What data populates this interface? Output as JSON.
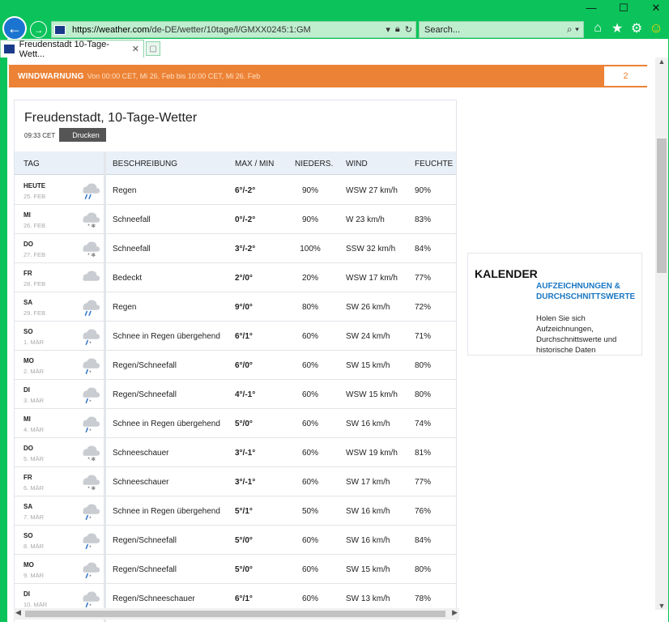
{
  "browser": {
    "url_host": "https://weather.com",
    "url_path": "/de-DE/wetter/10tage/l/GMXX0245:1:GM",
    "search_placeholder": "Search...",
    "tab_title": "Freudenstadt 10-Tage-Wett...",
    "tab_close": "✕"
  },
  "warning": {
    "title": "WINDWARNUNG",
    "time": "Von 00:00 CET, Mi 26. Feb bis 10:00 CET, Mi 26. Feb",
    "count": "2"
  },
  "page": {
    "title": "Freudenstadt, 10-Tage-Wetter",
    "time": "09:33 CET",
    "print_label": "Drucken"
  },
  "table": {
    "headers": {
      "day": "TAG",
      "desc": "BESCHREIBUNG",
      "temp": "MAX / MIN",
      "prec": "NIEDERS.",
      "wind": "WIND",
      "hum": "FEUCHTE"
    },
    "rows": [
      {
        "day": "HEUTE",
        "date": "25. FEB",
        "icon": "rain-icon",
        "desc": "Regen",
        "temp": "6°/-2°",
        "prec": "90%",
        "wind": "WSW 27 km/h",
        "hum": "90%"
      },
      {
        "day": "MI",
        "date": "26. FEB",
        "icon": "snow-icon",
        "desc": "Schneefall",
        "temp": "0°/-2°",
        "prec": "90%",
        "wind": "W 23 km/h",
        "hum": "83%"
      },
      {
        "day": "DO",
        "date": "27. FEB",
        "icon": "snow-icon",
        "desc": "Schneefall",
        "temp": "3°/-2°",
        "prec": "100%",
        "wind": "SSW 32 km/h",
        "hum": "84%"
      },
      {
        "day": "FR",
        "date": "28. FEB",
        "icon": "cloud-icon",
        "desc": "Bedeckt",
        "temp": "2°/0°",
        "prec": "20%",
        "wind": "WSW 17 km/h",
        "hum": "77%"
      },
      {
        "day": "SA",
        "date": "29. FEB",
        "icon": "rain-icon",
        "desc": "Regen",
        "temp": "9°/0°",
        "prec": "80%",
        "wind": "SW 26 km/h",
        "hum": "72%"
      },
      {
        "day": "SO",
        "date": "1. MÄR",
        "icon": "rain-snow-icon",
        "desc": "Schnee in Regen übergehend",
        "temp": "6°/1°",
        "prec": "60%",
        "wind": "SW 24 km/h",
        "hum": "71%"
      },
      {
        "day": "MO",
        "date": "2. MÄR",
        "icon": "rain-snow-icon",
        "desc": "Regen/Schneefall",
        "temp": "6°/0°",
        "prec": "60%",
        "wind": "SW 15 km/h",
        "hum": "80%"
      },
      {
        "day": "DI",
        "date": "3. MÄR",
        "icon": "rain-snow-icon",
        "desc": "Regen/Schneefall",
        "temp": "4°/-1°",
        "prec": "60%",
        "wind": "WSW 15 km/h",
        "hum": "80%"
      },
      {
        "day": "MI",
        "date": "4. MÄR",
        "icon": "rain-snow-icon",
        "desc": "Schnee in Regen übergehend",
        "temp": "5°/0°",
        "prec": "60%",
        "wind": "SW 16 km/h",
        "hum": "74%"
      },
      {
        "day": "DO",
        "date": "5. MÄR",
        "icon": "snow-icon",
        "desc": "Schneeschauer",
        "temp": "3°/-1°",
        "prec": "60%",
        "wind": "WSW 19 km/h",
        "hum": "81%"
      },
      {
        "day": "FR",
        "date": "6. MÄR",
        "icon": "snow-icon",
        "desc": "Schneeschauer",
        "temp": "3°/-1°",
        "prec": "60%",
        "wind": "SW 17 km/h",
        "hum": "77%"
      },
      {
        "day": "SA",
        "date": "7. MÄR",
        "icon": "rain-snow-icon",
        "desc": "Schnee in Regen übergehend",
        "temp": "5°/1°",
        "prec": "50%",
        "wind": "SW 16 km/h",
        "hum": "76%"
      },
      {
        "day": "SO",
        "date": "8. MÄR",
        "icon": "rain-snow-icon",
        "desc": "Regen/Schneefall",
        "temp": "5°/0°",
        "prec": "60%",
        "wind": "SW 16 km/h",
        "hum": "84%"
      },
      {
        "day": "MO",
        "date": "9. MÄR",
        "icon": "rain-snow-icon",
        "desc": "Regen/Schneefall",
        "temp": "5°/0°",
        "prec": "60%",
        "wind": "SW 15 km/h",
        "hum": "80%"
      },
      {
        "day": "DI",
        "date": "10. MÄR",
        "icon": "rain-snow-icon",
        "desc": "Regen/Schneeschauer",
        "temp": "6°/1°",
        "prec": "60%",
        "wind": "SW 13 km/h",
        "hum": "78%"
      }
    ]
  },
  "calendar": {
    "title": "KALENDER",
    "link": "AUFZEICHNUNGEN & DURCHSCHNITTSWERTE",
    "text": "Holen Sie sich Aufzeichnungen, Durchschnittswerte und historische Daten"
  },
  "colors": {
    "chrome": "#0bc35a",
    "warning": "#ec8235",
    "link": "#1877c4"
  }
}
